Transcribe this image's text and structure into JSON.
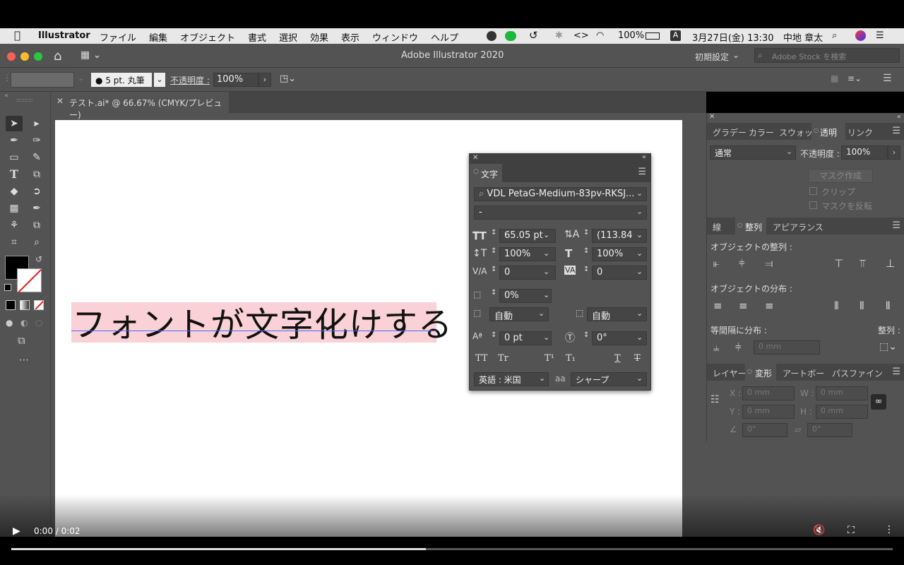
{
  "menubar": {
    "app": "Illustrator",
    "items": [
      "ファイル",
      "編集",
      "オブジェクト",
      "書式",
      "選択",
      "効果",
      "表示",
      "ウィンドウ",
      "ヘルプ"
    ],
    "battery": "100%",
    "input_mode": "A",
    "datetime": "3月27日(金) 13:30",
    "user": "中地 章太"
  },
  "titlebar": {
    "title": "Adobe Illustrator 2020",
    "workspace": "初期設定",
    "stock_search_placeholder": "Adobe Stock を検索"
  },
  "control": {
    "brush": "5 pt. 丸筆",
    "opacity_label": "不透明度 :",
    "opacity_value": "100%"
  },
  "document": {
    "tab_title": "テスト.ai* @ 66.67% (CMYK/プレビュー)",
    "artboard_text": "フォントが文字化けする"
  },
  "character_panel": {
    "tab": "文字",
    "font_family": "VDL PetaG-Medium-83pv-RKSJ...",
    "font_style": "-",
    "font_size": "65.05 pt",
    "leading": "(113.84",
    "vertical_scale": "100%",
    "horizontal_scale": "100%",
    "kerning": "0",
    "tracking": "0",
    "tsume": "0%",
    "aki_left": "自動",
    "aki_right": "自動",
    "baseline_shift": "0 pt",
    "rotation": "0°",
    "language": "英語 : 米国",
    "antialias_icon": "aa",
    "antialias": "シャープ",
    "style_buttons": [
      "TT",
      "Tr",
      "T¹",
      "T₁",
      "T",
      "T"
    ]
  },
  "transparency_panel": {
    "tabs": [
      "グラデー",
      "カラー",
      "スウォッ",
      "透明",
      "リンク"
    ],
    "blend_mode": "通常",
    "opacity_label": "不透明度 :",
    "opacity_value": "100%",
    "mask_button": "マスク作成",
    "clip_label": "クリップ",
    "invert_label": "マスクを反転"
  },
  "align_panel": {
    "tabs": [
      "線",
      "整列",
      "アピアランス"
    ],
    "align_objects_label": "オブジェクトの整列 :",
    "distribute_objects_label": "オブジェクトの分布 :",
    "distribute_spacing_label": "等間隔に分布 :",
    "align_to_label": "整列 :",
    "spacing_value": "0 mm"
  },
  "transform_panel": {
    "tabs": [
      "レイヤー",
      "変形",
      "アートボー",
      "パスファイン"
    ],
    "x_label": "X :",
    "y_label": "Y :",
    "w_label": "W :",
    "h_label": "H :",
    "x_value": "0 mm",
    "y_value": "0 mm",
    "w_value": "0 mm",
    "h_value": "0 mm",
    "angle_value": "0°",
    "shear_value": "0°"
  },
  "video": {
    "time": "0:00 / 0:02",
    "progress_fraction": 0.47
  },
  "colors": {
    "ui_bg": "#535353",
    "selection_highlight": "#f9d1d6",
    "baseline": "#4d6ef5",
    "menubar": "#e8e8e8"
  }
}
